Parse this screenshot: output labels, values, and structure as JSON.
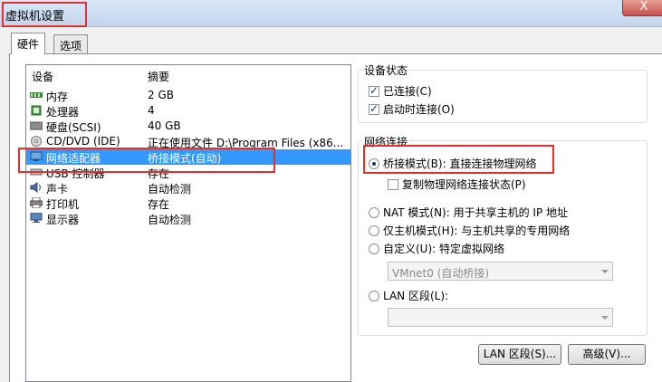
{
  "window": {
    "title": "虚拟机设置",
    "close_label": "X"
  },
  "tabs": [
    {
      "label": "硬件"
    },
    {
      "label": "选项"
    }
  ],
  "device_list": {
    "headers": {
      "device": "设备",
      "summary": "摘要"
    },
    "rows": [
      {
        "name": "内存",
        "summary": "2 GB",
        "icon": "memory-icon"
      },
      {
        "name": "处理器",
        "summary": "4",
        "icon": "processor-icon"
      },
      {
        "name": "硬盘(SCSI)",
        "summary": "40 GB",
        "icon": "hard-disk-icon"
      },
      {
        "name": "CD/DVD (IDE)",
        "summary": "正在使用文件 D:\\Program Files (x86...",
        "icon": "cd-dvd-icon"
      },
      {
        "name": "网络适配器",
        "summary": "桥接模式(自动)",
        "icon": "network-adapter-icon"
      },
      {
        "name": "USB 控制器",
        "summary": "存在",
        "icon": "usb-controller-icon"
      },
      {
        "name": "声卡",
        "summary": "自动检测",
        "icon": "sound-card-icon"
      },
      {
        "name": "打印机",
        "summary": "存在",
        "icon": "printer-icon"
      },
      {
        "name": "显示器",
        "summary": "自动检测",
        "icon": "display-icon"
      }
    ]
  },
  "device_status": {
    "title": "设备状态",
    "connected": "已连接(C)",
    "connect_at_power_on": "启动时连接(O)"
  },
  "network_connection": {
    "title": "网络连接",
    "bridged": "桥接模式(B): 直接连接物理网络",
    "replicate": "复制物理网络连接状态(P)",
    "nat": "NAT 模式(N): 用于共享主机的 IP 地址",
    "host_only": "仅主机模式(H): 与主机共享的专用网络",
    "custom": "自定义(U): 特定虚拟网络",
    "custom_value": "VMnet0 (自动桥接)",
    "lan_segment": "LAN 区段(L):",
    "lan_segment_value": ""
  },
  "buttons": {
    "lan_segments": "LAN 区段(S)...",
    "advanced": "高级(V)..."
  },
  "colors": {
    "selection": "#3399ff",
    "highlight": "#e03030",
    "titlebar": "#c3d5ec"
  }
}
